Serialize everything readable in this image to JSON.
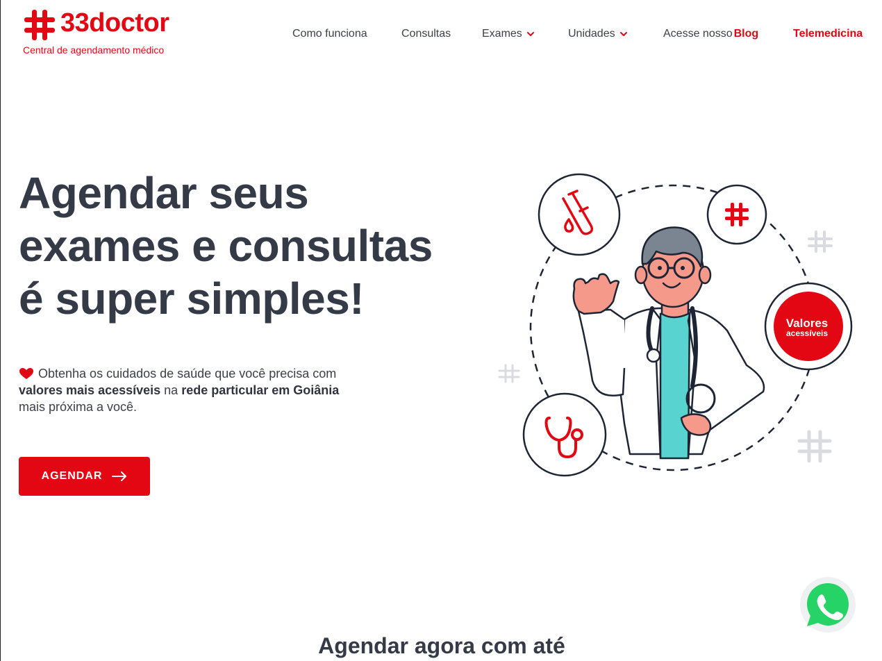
{
  "brand": {
    "name": "33doctor",
    "tagline": "Central de agendamento médico",
    "color": "#e30613"
  },
  "nav": {
    "how_it_works": "Como funciona",
    "consultations": "Consultas",
    "exams": "Exames",
    "units": "Unidades",
    "blog_prefix": "Acesse nosso",
    "blog_accent": "Blog",
    "telemedicine": "Telemedicina"
  },
  "hero": {
    "title_line1": "Agendar seus",
    "title_line2": "exames e consultas",
    "title_line3": "é super simples!",
    "desc_part1": "Obtenha os cuidados de saúde que você precisa com ",
    "desc_bold1": "valores mais acessíveis",
    "desc_part2": " na ",
    "desc_bold2": "rede particular em Goiânia",
    "desc_part3": " mais próxima a você.",
    "cta_label": "AGENDAR",
    "badge_line1": "Valores",
    "badge_line2": "acessíveis"
  },
  "section": {
    "title": "Agendar agora com até"
  },
  "icons": {
    "logo": "medical-cross-icon",
    "chevron": "chevron-down-icon",
    "heart": "heart-icon",
    "arrow": "arrow-right-icon",
    "test_tube": "test-tube-icon",
    "stethoscope": "stethoscope-icon",
    "whatsapp": "whatsapp-icon"
  }
}
